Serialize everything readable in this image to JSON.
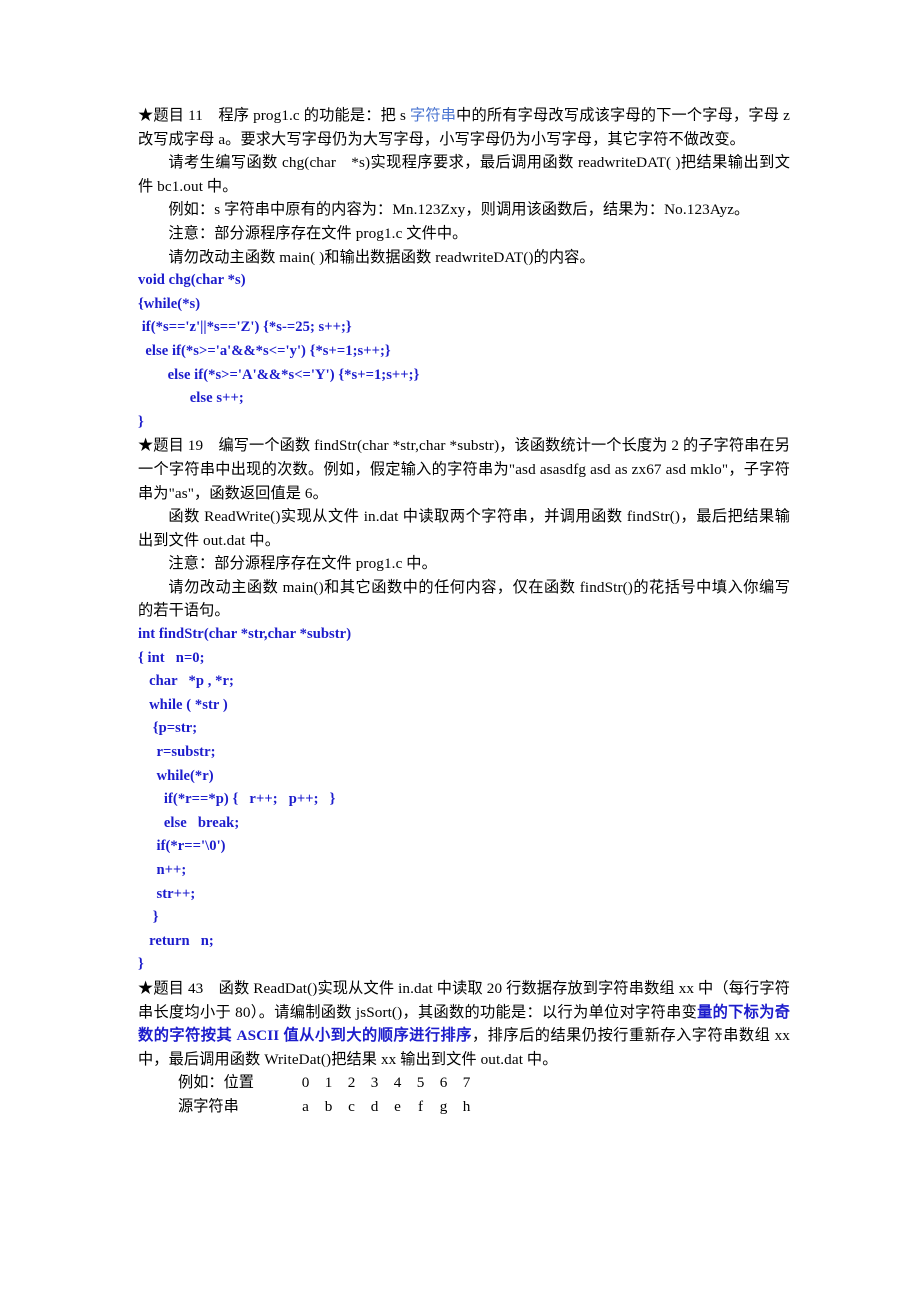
{
  "document": {
    "colors": {
      "code_blue": "#1c1ccc",
      "inline_blue": "#4a74d0",
      "text": "#000000",
      "background": "#ffffff"
    },
    "sections": [
      {
        "id": "problem-11",
        "heading_marker": "★题目 11",
        "paragraphs": [
          {
            "id": "p11-1",
            "parts": [
              {
                "text": "★题目 11 程序 prog1.c 的功能是：把 s ",
                "style": "normal"
              },
              {
                "text": "字符串",
                "style": "blue-inline"
              },
              {
                "text": "中的所有字母改写成该字母的下一个字母，字母 z 改写成字母 a。要求大写字母仍为大写字母，小写字母仍为小写字母，其它字符不做改变。",
                "style": "normal"
              }
            ]
          },
          {
            "id": "p11-2",
            "parts": [
              {
                "text": "请考生编写函数 chg(char *s)实现程序要求，最后调用函数 readwriteDAT( )把结果输出到文件 bc1.out 中。",
                "style": "normal"
              }
            ]
          },
          {
            "id": "p11-3",
            "parts": [
              {
                "text": "例如：s 字符串中原有的内容为：Mn.123Zxy，则调用该函数后，结果为：No.123Ayz。",
                "style": "normal"
              }
            ]
          },
          {
            "id": "p11-4",
            "parts": [
              {
                "text": "注意：部分源程序存在文件 prog1.c 文件中。",
                "style": "normal"
              }
            ]
          },
          {
            "id": "p11-5",
            "parts": [
              {
                "text": "请勿改动主函数 main( )和输出数据函数 readwriteDAT()的内容。",
                "style": "normal"
              }
            ]
          }
        ],
        "code_lines": [
          "void chg(char *s)",
          "{while(*s)",
          " if(*s=='z'||*s=='Z') {*s-=25; s++;}",
          "  else if(*s>='a'&&*s<='y') {*s+=1;s++;}",
          "        else if(*s>='A'&&*s<='Y') {*s+=1;s++;}",
          "              else s++;",
          "}"
        ]
      },
      {
        "id": "problem-19",
        "heading_marker": "★题目 19",
        "paragraphs": [
          {
            "id": "p19-1",
            "parts": [
              {
                "text": "★题目 19 编写一个函数 findStr(char *str,char *substr)，该函数统计一个长度为 2 的子字符串在另一个字符串中出现的次数。例如，假定输入的字符串为\"asd asasdfg asd as zx67 asd mklo\"，子字符串为\"as\"，函数返回值是 6。",
                "style": "normal"
              }
            ]
          },
          {
            "id": "p19-2",
            "parts": [
              {
                "text": "函数 ReadWrite()实现从文件 in.dat 中读取两个字符串，并调用函数 findStr()，最后把结果输出到文件 out.dat 中。",
                "style": "normal"
              }
            ]
          },
          {
            "id": "p19-3",
            "parts": [
              {
                "text": "注意：部分源程序存在文件 prog1.c 中。",
                "style": "normal"
              }
            ]
          },
          {
            "id": "p19-4",
            "parts": [
              {
                "text": "请勿改动主函数 main()和其它函数中的任何内容，仅在函数 findStr()的花括号中填入你编写的若干语句。",
                "style": "normal"
              }
            ]
          }
        ],
        "code_lines": [
          "int findStr(char *str,char *substr)",
          "{ int   n=0;",
          "   char   *p , *r;",
          "   while ( *str )",
          "    {p=str;",
          "     r=substr;",
          "     while(*r)",
          "       if(*r==*p) {   r++;   p++;   }",
          "       else   break;",
          "     if(*r=='\\0')",
          "     n++;",
          "     str++;",
          "    }",
          "   return   n;",
          "}"
        ]
      },
      {
        "id": "problem-43",
        "heading_marker": "★题目 43",
        "paragraphs": [
          {
            "id": "p43-1",
            "parts": [
              {
                "text": "★题目 43 函数 ReadDat()实现从文件 in.dat 中读取 20 行数据存放到字符串数组 xx 中（每行字符串长度均小于 80）。请编制函数 jsSort()，其函数的功能是：以行为单位对字符串变",
                "style": "normal"
              },
              {
                "text": "量的下标为奇数的字符按其 ASCII 值从小到大的顺序进行排序",
                "style": "blue-bold"
              },
              {
                "text": "，排序后的结果仍按行重新存入字符串数组 xx 中，最后调用函数 WriteDat()把结果 xx 输出到文件 out.dat 中。",
                "style": "normal"
              }
            ]
          }
        ],
        "example": {
          "rows": [
            {
              "label": "例如：位置",
              "cells": [
                "0",
                "1",
                "2",
                "3",
                "4",
                "5",
                "6",
                "7"
              ]
            },
            {
              "label": "源字符串",
              "cells": [
                "a",
                "b",
                "c",
                "d",
                "e",
                "f",
                "g",
                "h"
              ]
            }
          ]
        }
      }
    ]
  }
}
